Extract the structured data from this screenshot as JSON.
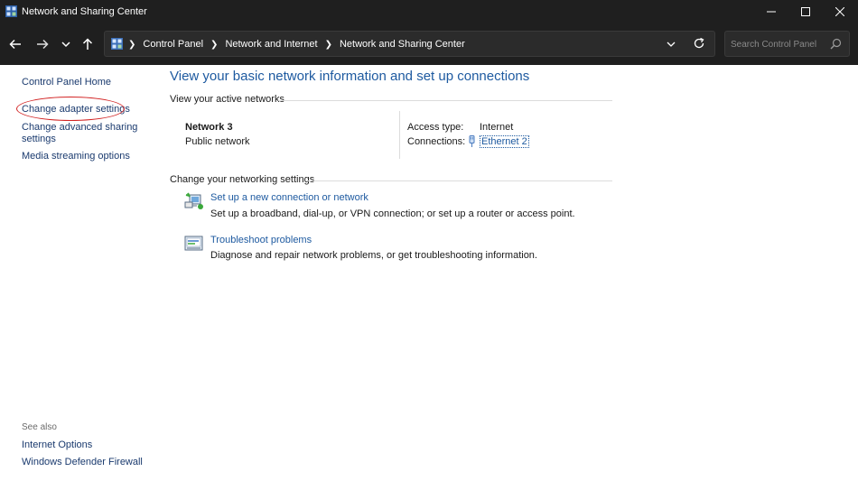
{
  "window": {
    "title": "Network and Sharing Center",
    "controls": {
      "minimize_icon": "minimize-icon",
      "maximize_icon": "maximize-icon",
      "close_icon": "close-icon"
    }
  },
  "navigation": {
    "back_icon": "back-arrow-icon",
    "forward_icon": "forward-arrow-icon",
    "recent_icon": "chevron-down-icon",
    "up_icon": "up-arrow-icon",
    "breadcrumb": [
      "Control Panel",
      "Network and Internet",
      "Network and Sharing Center"
    ],
    "search_placeholder": "Search Control Panel"
  },
  "sidebar": {
    "links": [
      "Control Panel Home",
      "Change adapter settings",
      "Change advanced sharing settings",
      "Media streaming options"
    ],
    "advanced_line1": "Change advanced sharing",
    "advanced_line2": "settings",
    "highlighted": "Change adapter settings",
    "highlight_color": "#d22323",
    "see_also_title": "See also",
    "see_also": [
      "Internet Options",
      "Windows Defender Firewall"
    ]
  },
  "main": {
    "title": "View your basic network information and set up connections",
    "active_networks_heading": "View your active networks",
    "network": {
      "name": "Network 3",
      "category": "Public network",
      "access_type_label": "Access type:",
      "access_type_value": "Internet",
      "connections_label": "Connections:",
      "connections_value": "Ethernet 2"
    },
    "settings_heading": "Change your networking settings",
    "tasks": [
      {
        "icon": "new-connection-icon",
        "title": "Set up a new connection or network",
        "description": "Set up a broadband, dial-up, or VPN connection; or set up a router or access point."
      },
      {
        "icon": "troubleshoot-icon",
        "title": "Troubleshoot problems",
        "description": "Diagnose and repair network problems, or get troubleshooting information."
      }
    ]
  },
  "colors": {
    "chrome_bg": "#1f1f1f",
    "link_blue": "#1e5aa0",
    "nav_link": "#1a3a6e",
    "annotation_red": "#d22323"
  }
}
